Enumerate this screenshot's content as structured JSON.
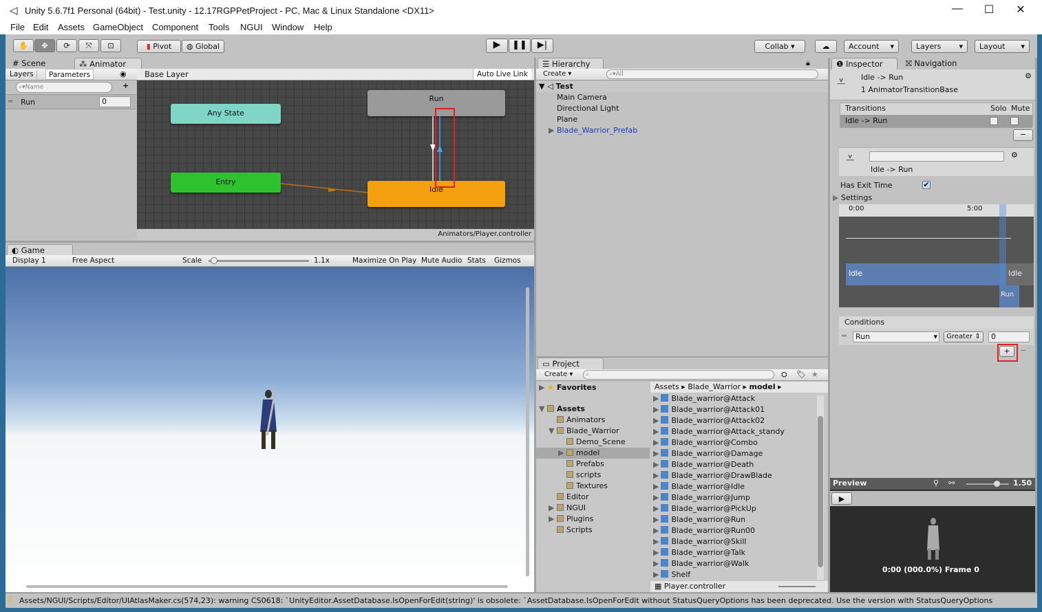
{
  "window": {
    "title": "Unity 5.6.7f1 Personal (64bit) - Test.unity - 12.17RGPPetProject - PC, Mac & Linux Standalone <DX11>",
    "min": "—",
    "max": "☐",
    "close": "✕"
  },
  "menu": [
    "File",
    "Edit",
    "Assets",
    "GameObject",
    "Component",
    "Tools",
    "NGUI",
    "Window",
    "Help"
  ],
  "toolbar": {
    "pivot": "Pivot",
    "global": "Global",
    "collab": "Collab ▾",
    "account": "Account",
    "layers": "Layers",
    "layout": "Layout"
  },
  "animator": {
    "tab_scene": "Scene",
    "tab_animator": "Animator",
    "tab_layers": "Layers",
    "tab_parameters": "Parameters",
    "search_placeholder": "Name",
    "param_name": "Run",
    "param_value": "0",
    "breadcrumb": "Base Layer",
    "auto_live_link": "Auto Live Link",
    "nodes": {
      "any": "Any State",
      "entry": "Entry",
      "run": "Run",
      "idle": "Idle"
    },
    "path": "Animators/Player.controller"
  },
  "game": {
    "tab": "Game",
    "display": "Display 1",
    "aspect": "Free Aspect",
    "scale_label": "Scale",
    "scale_value": "1.1x",
    "scale_fraction": 0.02,
    "maximize": "Maximize On Play",
    "mute": "Mute Audio",
    "stats": "Stats",
    "gizmos": "Gizmos"
  },
  "hierarchy": {
    "tab": "Hierarchy",
    "create": "Create",
    "search_placeholder": "All",
    "scene": "Test",
    "items": [
      "Main Camera",
      "Directional Light",
      "Plane",
      "Blade_Warrior_Prefab"
    ]
  },
  "project": {
    "tab": "Project",
    "create": "Create",
    "favorites": "Favorites",
    "tree": [
      {
        "label": "Assets",
        "level": 0
      },
      {
        "label": "Animators",
        "level": 1
      },
      {
        "label": "Blade_Warrior",
        "level": 1
      },
      {
        "label": "Demo_Scene",
        "level": 2
      },
      {
        "label": "model",
        "level": 2
      },
      {
        "label": "Prefabs",
        "level": 2
      },
      {
        "label": "scripts",
        "level": 2
      },
      {
        "label": "Textures",
        "level": 2
      },
      {
        "label": "Editor",
        "level": 1
      },
      {
        "label": "NGUI",
        "level": 1
      },
      {
        "label": "Plugins",
        "level": 1
      },
      {
        "label": "Scripts",
        "level": 1
      }
    ],
    "breadcrumb": [
      "Assets",
      "Blade_Warrior",
      "model"
    ],
    "files": [
      "Blade_warrior@Attack",
      "Blade_warrior@Attack01",
      "Blade_warrior@Attack02",
      "Blade_warrior@Attack_standy",
      "Blade_warrior@Combo",
      "Blade_warrior@Damage",
      "Blade_warrior@Death",
      "Blade_warrior@DrawBlade",
      "Blade_warrior@Idle",
      "Blade_warrior@Jump",
      "Blade_warrior@PickUp",
      "Blade_warrior@Run",
      "Blade_warrior@Run00",
      "Blade_warrior@Skill",
      "Blade_warrior@Talk",
      "Blade_warrior@Walk",
      "Shelf"
    ],
    "selected_file": "Player.controller"
  },
  "inspector": {
    "tab": "Inspector",
    "tab_nav": "Navigation",
    "title": "Idle -> Run",
    "subtitle": "1 AnimatorTransitionBase",
    "transitions_header": "Transitions",
    "solo": "Solo",
    "mute": "Mute",
    "transition_row": "Idle -> Run",
    "transition_name": "Idle -> Run",
    "has_exit_time": "Has Exit Time",
    "has_exit_checked": true,
    "settings": "Settings",
    "timeline": {
      "t0": "0:00",
      "t1": "5:00",
      "idle": "Idle",
      "idle2": "Idle",
      "run": "Run"
    },
    "conditions": "Conditions",
    "cond_param": "Run",
    "cond_op": "Greater",
    "cond_value": "0",
    "preview": "Preview",
    "preview_speed": "1.50",
    "preview_frame": "0:00 (000.0%) Frame 0"
  },
  "status": {
    "message": "Assets/NGUI/Scripts/Editor/UIAtlasMaker.cs(574,23): warning CS0618: `UnityEditor.AssetDatabase.IsOpenForEdit(string)' is obsolete: `AssetDatabase.IsOpenForEdit without StatusQueryOptions has been deprecated. Use the version with StatusQueryOptions"
  },
  "colors": {
    "any_state": "#7fd6c6",
    "entry": "#2ec22e",
    "idle": "#f5a00f",
    "run": "#9a9a9a",
    "highlight": "#e02020"
  }
}
